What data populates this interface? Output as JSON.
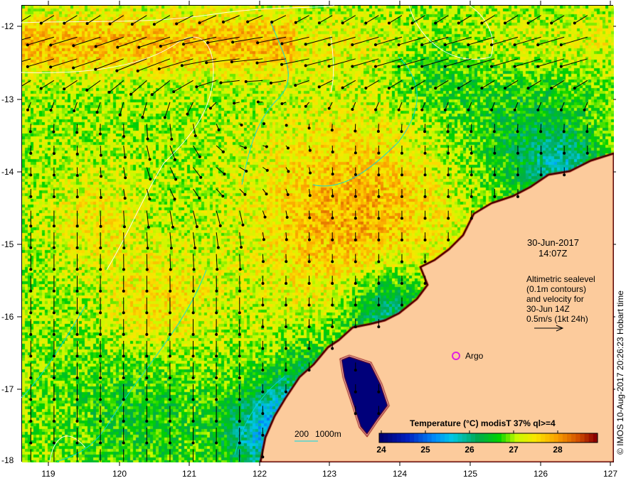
{
  "map": {
    "date": "30-Jun-2017",
    "time": "14:07Z",
    "annotation": [
      "Altimetric sealevel",
      "(0.1m contours)",
      "and velocity for",
      "30-Jun 14Z",
      "0.5m/s (1kt 24h)"
    ],
    "argo_label": "Argo",
    "scale_labels": [
      "200",
      "1000m"
    ],
    "credit": "© IMOS 10-Aug-2017 20:26:23 Hobart time",
    "colors": {
      "land": "#fccb9c",
      "argo": "#e020e0",
      "contour": "#ffffff",
      "bathy": "#00d8e8"
    }
  },
  "axes": {
    "x_ticks": [
      "119",
      "120",
      "121",
      "122",
      "123",
      "124",
      "125",
      "126",
      "127"
    ],
    "y_ticks": [
      "-12",
      "-13",
      "-14",
      "-15",
      "-16",
      "-17",
      "-18"
    ]
  },
  "colorbar": {
    "title": "Temperature (°C) modisT 37% ql>=4",
    "ticks": [
      "24",
      "25",
      "26",
      "27",
      "28"
    ],
    "range": [
      23.9,
      28.85
    ]
  }
}
